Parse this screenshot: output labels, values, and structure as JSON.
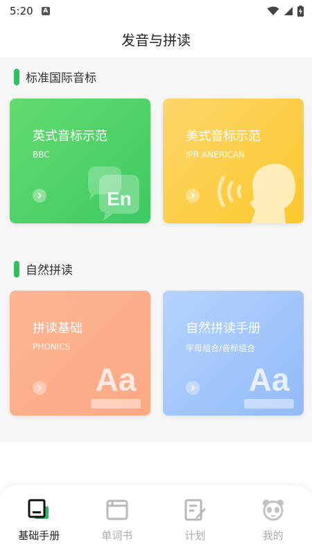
{
  "status_bar": {
    "time": "5:20",
    "notification_icon_letter": "A"
  },
  "header": {
    "title": "发音与拼读"
  },
  "sections": [
    {
      "title": "标准国际音标",
      "cards": [
        {
          "title": "英式音标示范",
          "subtitle": "BBC",
          "color": "#4fd067",
          "illustration": "En"
        },
        {
          "title": "美式音标示范",
          "subtitle": "IPR ANERICAN",
          "color": "#fccd3e",
          "illustration": "speaking-head"
        }
      ]
    },
    {
      "title": "自然拼读",
      "cards": [
        {
          "title": "拼读基础",
          "subtitle": "PHONICS",
          "color": "#fcaf8b",
          "illustration": "Aa"
        },
        {
          "title": "自然拼读手册",
          "subtitle": "字母组合/音标组合",
          "color": "#a3c6fb",
          "illustration": "Aa"
        }
      ]
    }
  ],
  "bottom_nav": {
    "active_index": 0,
    "items": [
      {
        "label": "基础手册",
        "icon": "handbook-icon"
      },
      {
        "label": "单词书",
        "icon": "wordbook-icon"
      },
      {
        "label": "计划",
        "icon": "plan-icon"
      },
      {
        "label": "我的",
        "icon": "panda-icon"
      }
    ]
  },
  "colors": {
    "accent": "#2dbe60",
    "background": "#f6f6f6"
  }
}
